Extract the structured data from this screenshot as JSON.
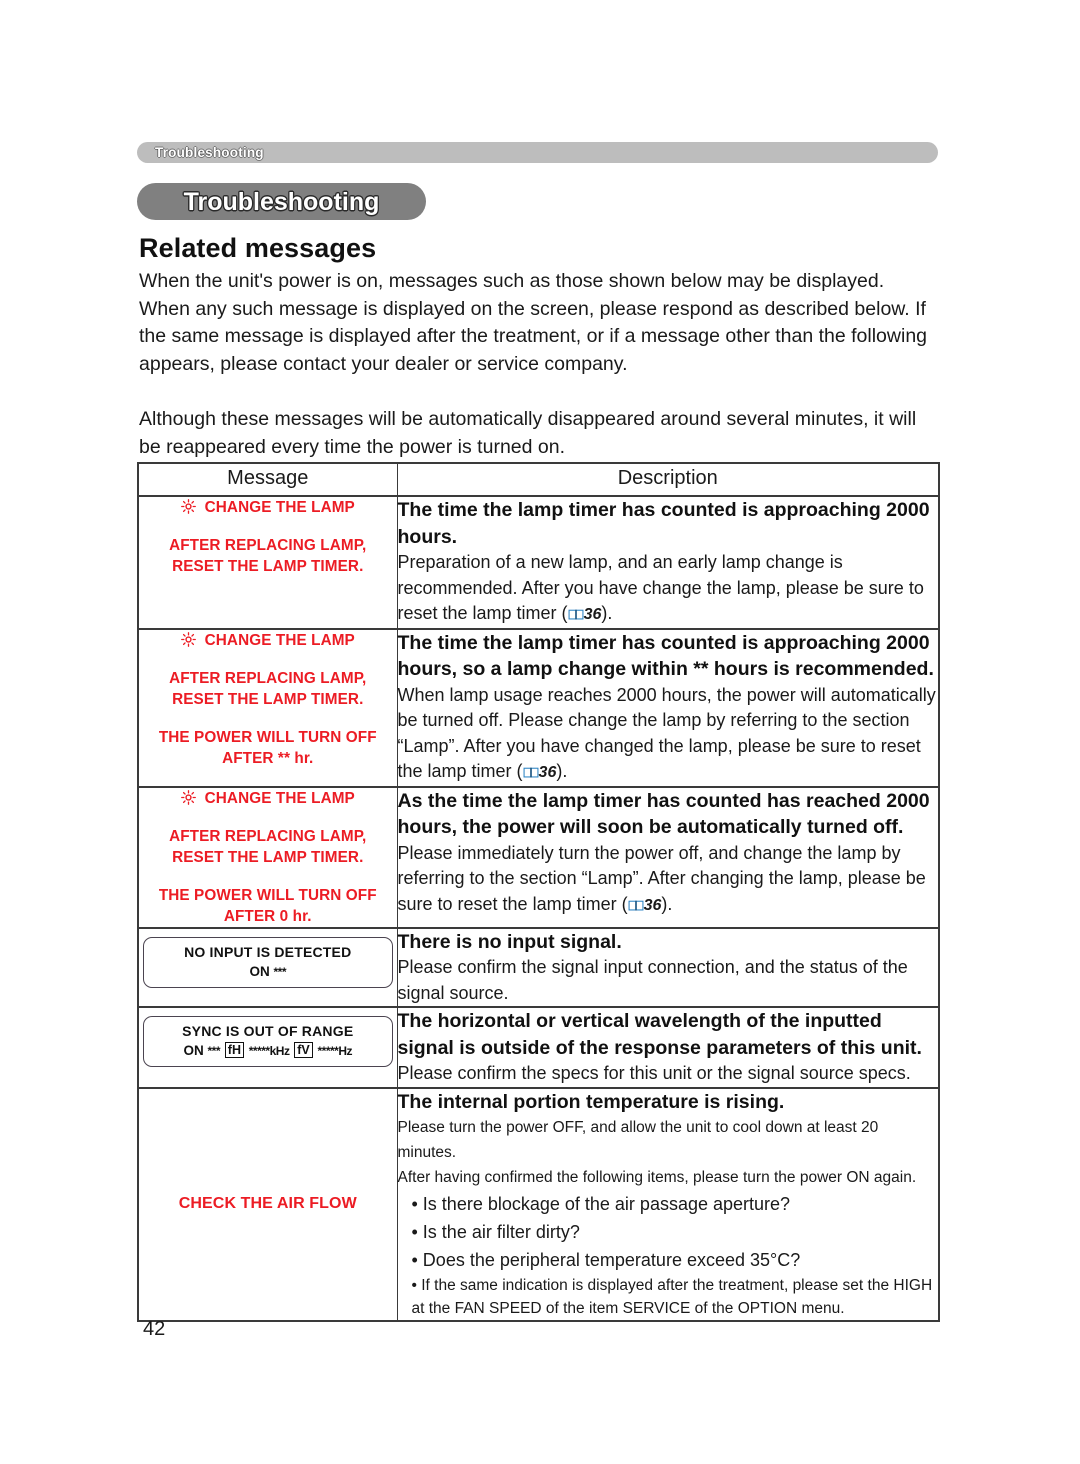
{
  "document": {
    "running_header": "Troubleshooting",
    "chapter_title": "Troubleshooting",
    "section_heading": "Related messages",
    "page_number": "42",
    "accent_red": "#ec1c24",
    "pill_gray": "#808080",
    "header_bar_gray": "#bdbdbd",
    "book_icon_blue": "#2f86c5"
  },
  "intro": {
    "paragraph_1": "When the unit's power is on, messages such as those shown below may be displayed. When any such message is displayed on the screen, please respond as described below. If the same message is displayed after the treatment, or if a message other than the following appears, please contact your dealer or service company.",
    "paragraph_2": "Although these messages will be automatically disappeared around several minutes, it will be reappeared every time the power is turned on."
  },
  "table": {
    "headers": {
      "message": "Message",
      "description": "Description"
    },
    "rows": [
      {
        "message": {
          "icon": "lamp-sun-icon",
          "groups": [
            [
              "CHANGE THE LAMP"
            ],
            [
              "AFTER REPLACING LAMP,",
              "RESET THE LAMP TIMER."
            ]
          ]
        },
        "description": {
          "head": "The time the lamp timer has counted is approaching 2000 hours.",
          "body_before": "Preparation of a new lamp, and an early lamp change is recommended. After you have change the lamp, please be sure to reset the lamp timer (",
          "page_ref": "36",
          "body_after": ")."
        }
      },
      {
        "message": {
          "icon": "lamp-sun-icon",
          "groups": [
            [
              "CHANGE THE LAMP"
            ],
            [
              "AFTER REPLACING LAMP,",
              "RESET THE LAMP TIMER."
            ],
            [
              "THE POWER WILL TURN OFF",
              "AFTER ** hr."
            ]
          ]
        },
        "description": {
          "head": "The time the lamp timer has counted is approaching 2000 hours, so a lamp change within ** hours is recommended.",
          "body_before": "When lamp usage reaches 2000 hours, the power will automatically be turned off. Please change the lamp by referring to the section “Lamp”. After you have changed the lamp, please be sure to reset the lamp timer (",
          "page_ref": "36",
          "body_after": ")."
        }
      },
      {
        "message": {
          "icon": "lamp-sun-icon",
          "groups": [
            [
              "CHANGE THE LAMP"
            ],
            [
              "AFTER REPLACING LAMP,",
              "RESET THE LAMP TIMER."
            ],
            [
              "THE POWER WILL TURN OFF",
              "AFTER 0 hr."
            ]
          ]
        },
        "description": {
          "head": "As the time the lamp timer has counted has reached 2000 hours, the power will soon be automatically turned off.",
          "body_before": "Please immediately turn the power off, and change the lamp by referring to the section “Lamp”. After changing the lamp, please be sure to reset the lamp timer (",
          "page_ref": "36",
          "body_after": ")."
        }
      },
      {
        "message": {
          "osd": {
            "line1": "NO INPUT IS DETECTED",
            "line2_prefix": "ON",
            "line2_stars": "***"
          }
        },
        "description": {
          "head": "There is no input signal.",
          "body": "Please confirm the signal input connection, and the status of the signal source."
        }
      },
      {
        "message": {
          "osd_sync": {
            "line1": "SYNC IS OUT OF RANGE",
            "on_label": "ON",
            "on_stars": "***",
            "fh_label": "fH",
            "fh_value": "*****kHz",
            "fv_label": "fV",
            "fv_value": "*****Hz"
          }
        },
        "description": {
          "head": "The horizontal or vertical wavelength of the inputted signal is outside of the response parameters of this unit.",
          "body": "Please confirm the specs for this unit or the signal source specs."
        }
      },
      {
        "message": {
          "plain": "CHECK THE AIR FLOW"
        },
        "description": {
          "head": "The internal portion temperature is rising.",
          "body_small_1": "Please turn the power OFF, and allow the unit to cool down at least 20 minutes.",
          "body_small_2": "After having confirmed the following items, please turn the power ON again.",
          "bullets": [
            "• Is there blockage of the air passage aperture?",
            "• Is the air filter dirty?",
            "• Does the peripheral temperature exceed 35°C?"
          ],
          "bullet_small": "• If the same indication is displayed after the treatment, please set the HIGH at the FAN SPEED of the item SERVICE of the OPTION menu."
        }
      }
    ]
  }
}
